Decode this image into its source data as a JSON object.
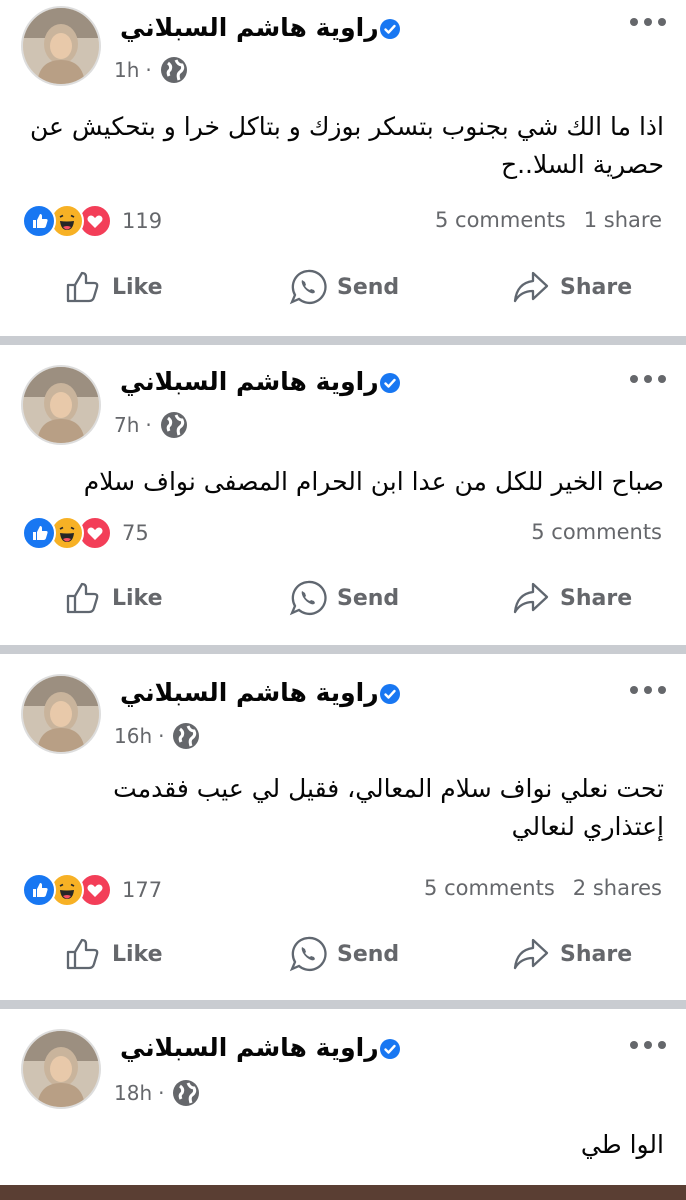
{
  "colors": {
    "verified": "#1877f2",
    "like_reaction": "#1877f2",
    "haha_reaction": "#f7b125",
    "love_reaction": "#f33e58",
    "separator": "#c9ccd1",
    "secondary_text": "#65676b"
  },
  "icons": {
    "verified": "verified-badge-icon",
    "privacy": "globe-icon",
    "more": "more-options-icon",
    "reactions": [
      "like-reaction-icon",
      "haha-reaction-icon",
      "love-reaction-icon"
    ],
    "like": "thumbs-up-icon",
    "send": "whatsapp-icon",
    "share": "share-arrow-icon"
  },
  "actions": {
    "like": "Like",
    "send": "Send",
    "share": "Share"
  },
  "posts": [
    {
      "author": "راوية هاشم السبلاني",
      "time": "1h",
      "dot": "·",
      "text": "اذا ما الك شي بجنوب بتسكر بوزك و بتاكل خرا و بتحكيش عن حصرية السلا..ح",
      "reaction_count": "119",
      "comments": "5 comments",
      "shares": "1 share"
    },
    {
      "author": "راوية هاشم السبلاني",
      "time": "7h",
      "dot": "·",
      "text": "صباح الخير للكل من عدا ابن الحرام المصفى نواف سلام",
      "reaction_count": "75",
      "comments": "5 comments",
      "shares": ""
    },
    {
      "author": "راوية هاشم السبلاني",
      "time": "16h",
      "dot": "·",
      "text": "تحت نعلي نواف سلام المعالي، فقيل لي عيب فقدمت إعتذاري لنعالي",
      "reaction_count": "177",
      "comments": "5 comments",
      "shares": "2 shares"
    },
    {
      "author": "راوية هاشم السبلاني",
      "time": "18h",
      "dot": "·",
      "text": "الوا طي"
    }
  ]
}
